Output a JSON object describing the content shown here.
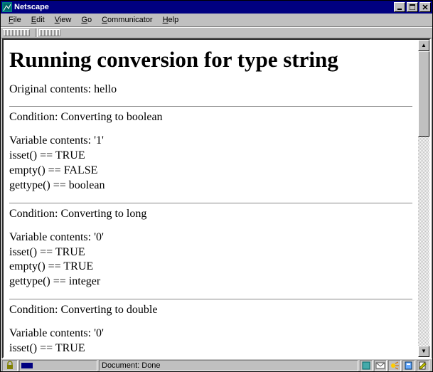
{
  "window": {
    "title": "Netscape"
  },
  "menu": {
    "file": "File",
    "edit": "Edit",
    "view": "View",
    "go": "Go",
    "communicator": "Communicator",
    "help": "Help"
  },
  "document": {
    "heading": "Running conversion for type string",
    "original_label": "Original contents: hello",
    "sections": [
      {
        "condition": "Condition: Converting to boolean",
        "contents": "Variable contents: '1'",
        "isset": "isset() == TRUE",
        "empty": "empty() == FALSE",
        "gettype": "gettype() == boolean"
      },
      {
        "condition": "Condition: Converting to long",
        "contents": "Variable contents: '0'",
        "isset": "isset() == TRUE",
        "empty": "empty() == TRUE",
        "gettype": "gettype() == integer"
      },
      {
        "condition": "Condition: Converting to double",
        "contents": "Variable contents: '0'",
        "isset": "isset() == TRUE"
      }
    ]
  },
  "status": {
    "message": "Document: Done"
  }
}
